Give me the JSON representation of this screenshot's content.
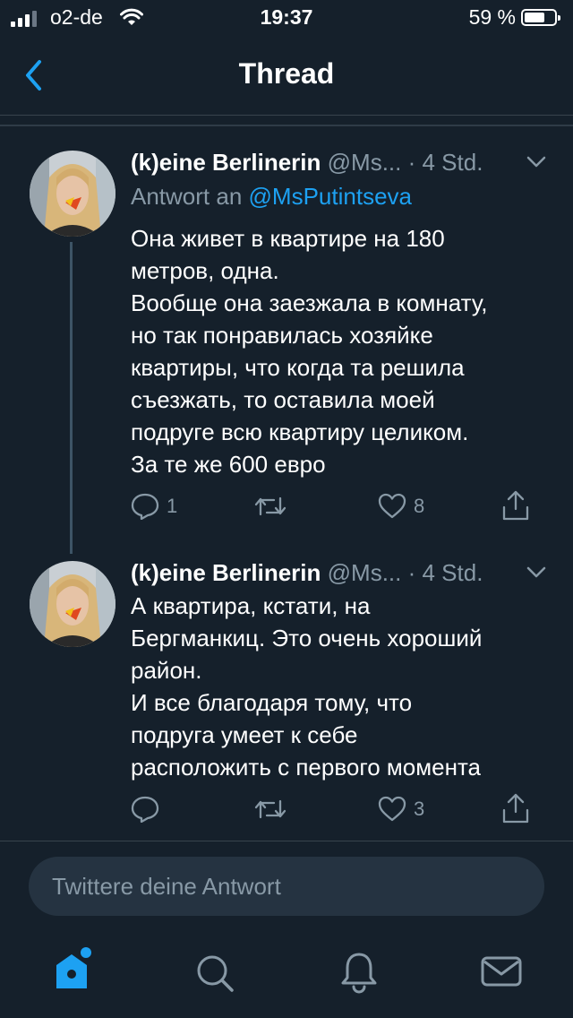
{
  "status_bar": {
    "carrier": "o2-de",
    "time": "19:37",
    "battery": "59 %"
  },
  "header": {
    "title": "Thread",
    "back_icon": "chevron-left-icon"
  },
  "tweets": [
    {
      "name": "(k)eine Berlinerin",
      "handle": "@Ms...",
      "time": "· 4 Std.",
      "reply_prefix": "Antwort an",
      "reply_to": "@MsPutintseva",
      "text": "Она живет в квартире на 180\nметров, одна.\nВообще она заезжала в комнату,\nно так понравилась хозяйке\nквартиры, что когда та решила\nсъезжать, то оставила моей\nподруге всю квартиру целиком.\nЗа те же 600 евро",
      "replies": "1",
      "retweets": "",
      "likes": "8"
    },
    {
      "name": "(k)eine Berlinerin",
      "handle": "@Ms...",
      "time": "· 4 Std.",
      "text": "А квартира, кстати, на\nБергманкиц. Это очень хороший\nрайон.\nИ все благодаря тому, что\nподруга умеет к себе\nрасположить с первого момента",
      "replies": "",
      "retweets": "",
      "likes": "3"
    }
  ],
  "composer": {
    "placeholder": "Twittere deine Antwort"
  },
  "tab_bar": {
    "items": [
      "home-icon",
      "search-icon",
      "notifications-icon",
      "messages-icon"
    ],
    "accent": "#1da1f2"
  },
  "colors": {
    "background": "#15202b",
    "muted": "#8899a6",
    "accent": "#1da1f2"
  }
}
